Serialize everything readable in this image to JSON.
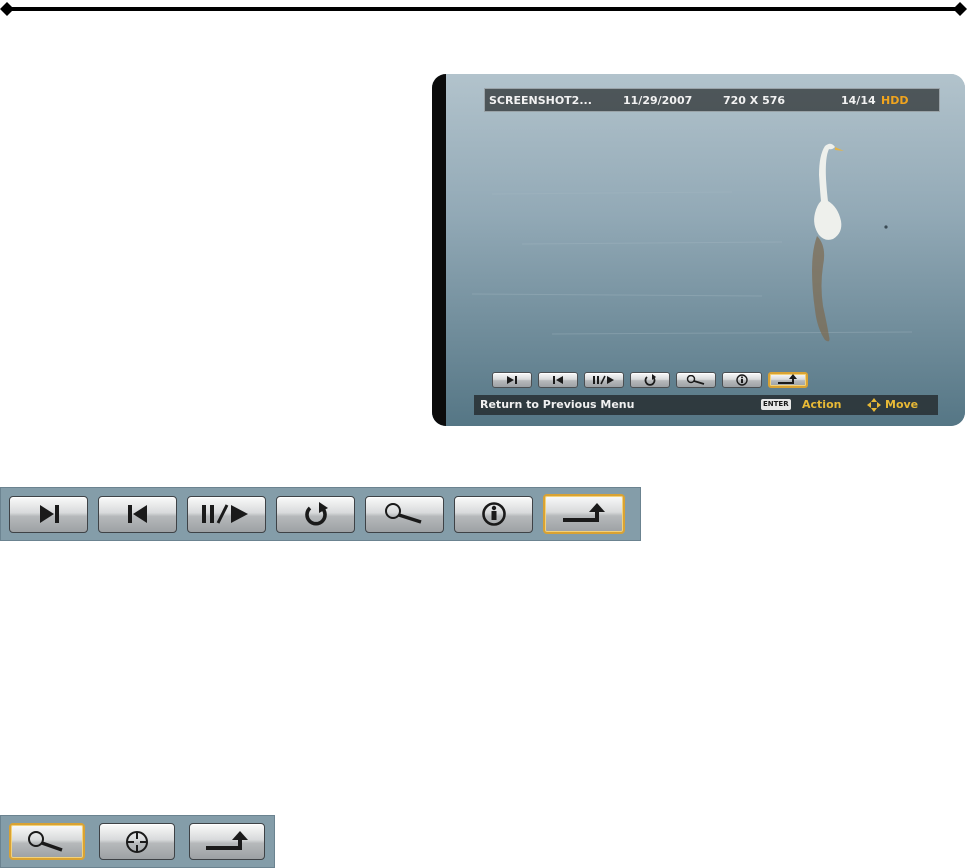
{
  "osd": {
    "info_bar": {
      "filename": "SCREENSHOT2...",
      "date": "11/29/2007",
      "resolution": "720 X 576",
      "count": "14/14",
      "source": "HDD"
    },
    "status_bar": {
      "hint": "Return to Previous Menu",
      "enter_key": "ENTER",
      "action": "Action",
      "move": "Move"
    },
    "colors": {
      "accent": "#d9a233",
      "highlight_text": "#e8b936",
      "source_text": "#f0a41e",
      "strip_bg": "#849da9"
    }
  },
  "controls": [
    {
      "name": "next-button",
      "icon": "next-track-icon"
    },
    {
      "name": "previous-button",
      "icon": "previous-track-icon"
    },
    {
      "name": "pause-play-button",
      "icon": "pause-play-icon"
    },
    {
      "name": "rotate-button",
      "icon": "rotate-icon"
    },
    {
      "name": "zoom-button",
      "icon": "magnifier-icon"
    },
    {
      "name": "info-button",
      "icon": "info-icon"
    },
    {
      "name": "return-button",
      "icon": "return-arrow-icon",
      "selected": true
    }
  ],
  "zoom_controls": [
    {
      "name": "zoom-button",
      "icon": "magnifier-icon",
      "selected": true
    },
    {
      "name": "pan-button",
      "icon": "crosshair-icon"
    },
    {
      "name": "return-button",
      "icon": "return-arrow-icon"
    }
  ]
}
